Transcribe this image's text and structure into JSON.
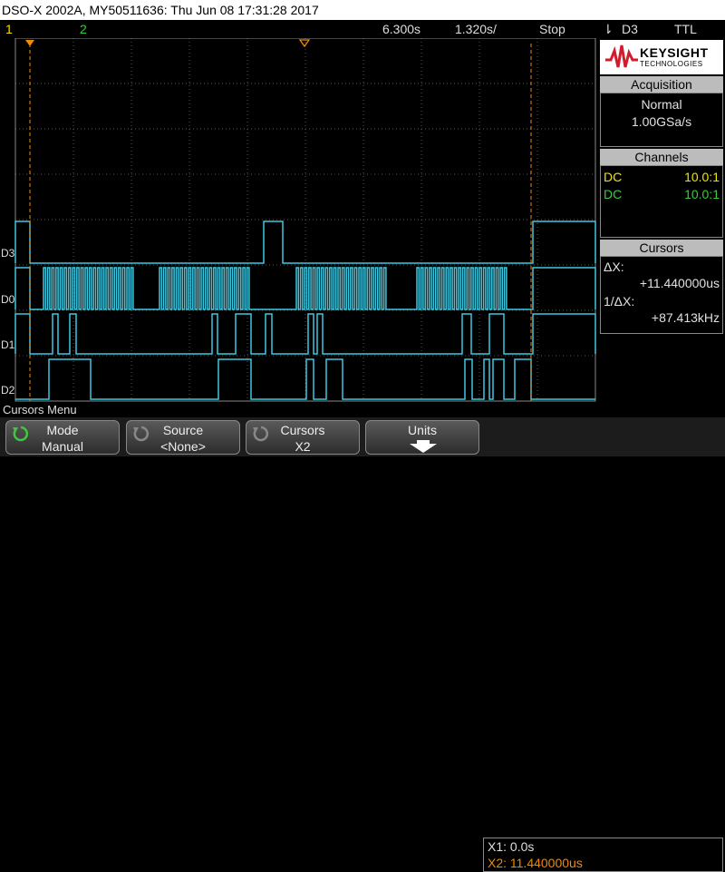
{
  "title": "DSO-X 2002A, MY50511636: Thu Jun 08 17:31:28 2017",
  "status": {
    "ch1": "1",
    "ch2": "2",
    "timebase": "6.300s",
    "delay": "1.320s/",
    "run_state": "Stop",
    "trig_icon": "⇂",
    "trig_source": "D3",
    "trig_level": "TTL"
  },
  "brand": {
    "name": "KEYSIGHT",
    "sub": "TECHNOLOGIES"
  },
  "acquisition": {
    "header": "Acquisition",
    "mode": "Normal",
    "rate": "1.00GSa/s"
  },
  "channels": {
    "header": "Channels",
    "rows": [
      {
        "coupling": "DC",
        "probe": "10.0:1"
      },
      {
        "coupling": "DC",
        "probe": "10.0:1"
      }
    ]
  },
  "cursors": {
    "header": "Cursors",
    "dx_label": "ΔX:",
    "dx_value": "+11.440000us",
    "inv_label": "1/ΔX:",
    "inv_value": "+87.413kHz"
  },
  "digital_labels": [
    "D3",
    "D0",
    "D1",
    "D2"
  ],
  "menu_title": "Cursors Menu",
  "softkeys": [
    {
      "top": "Mode",
      "bottom": "Manual"
    },
    {
      "top": "Source",
      "bottom": "<None>"
    },
    {
      "top": "Cursors",
      "bottom": "X2"
    },
    {
      "top": "Units",
      "bottom": ""
    }
  ],
  "readout": {
    "x1": "X1: 0.0s",
    "x2": "X2: 11.440000us"
  },
  "colors": {
    "trace": "#3ec8e0",
    "cursor": "#f28a00",
    "ch1": "#f2e300",
    "ch2": "#3ec83e",
    "grid": "#555555"
  }
}
